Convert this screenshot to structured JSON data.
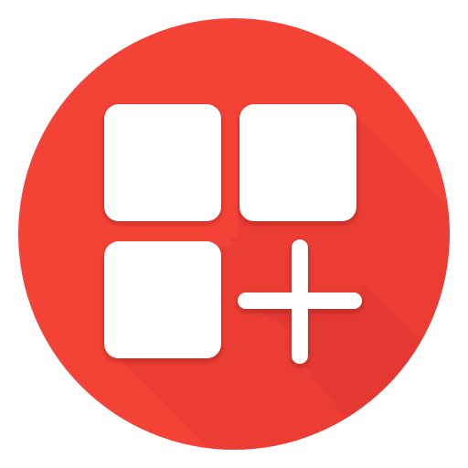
{
  "icon": {
    "name": "add-apps-grid-icon",
    "colors": {
      "background": "#ffffff",
      "circle": "#f44336",
      "circle_shadow": "#d32f2f",
      "glyph": "#ffffff",
      "glyph_shadow": "#8b1d1d"
    }
  }
}
